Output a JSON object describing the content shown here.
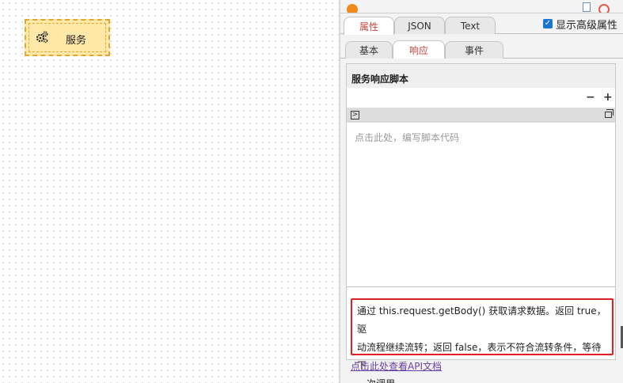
{
  "canvas": {
    "node": {
      "label": "服务",
      "icon": "gears-icon"
    }
  },
  "panel": {
    "main_tabs": [
      {
        "label": "属性",
        "active": true
      },
      {
        "label": "JSON",
        "active": false
      },
      {
        "label": "Text",
        "active": false
      }
    ],
    "advanced_toggle": {
      "label": "显示高级属性",
      "checked": true
    },
    "sub_tabs": [
      {
        "label": "基本",
        "active": false
      },
      {
        "label": "响应",
        "active": true
      },
      {
        "label": "事件",
        "active": false
      }
    ],
    "section_title": "服务响应脚本",
    "minus": "−",
    "plus": "+",
    "editor": {
      "placeholder": "点击此处，编写脚本代码"
    },
    "description_lines": [
      "通过 this.request.getBody() 获取请求数据。返回 true，驱",
      "动流程继续流转；返回 false，表示不符合流转条件，等待下",
      "一次调用"
    ],
    "api_link": "点击此处查看API文档"
  },
  "colors": {
    "node_fill": "#ffe8a8",
    "node_border": "#e3a72f",
    "active_tab_text": "#c2463c",
    "highlight_border": "#e02020",
    "link": "#6a3fa5",
    "checkbox": "#1976d2"
  }
}
